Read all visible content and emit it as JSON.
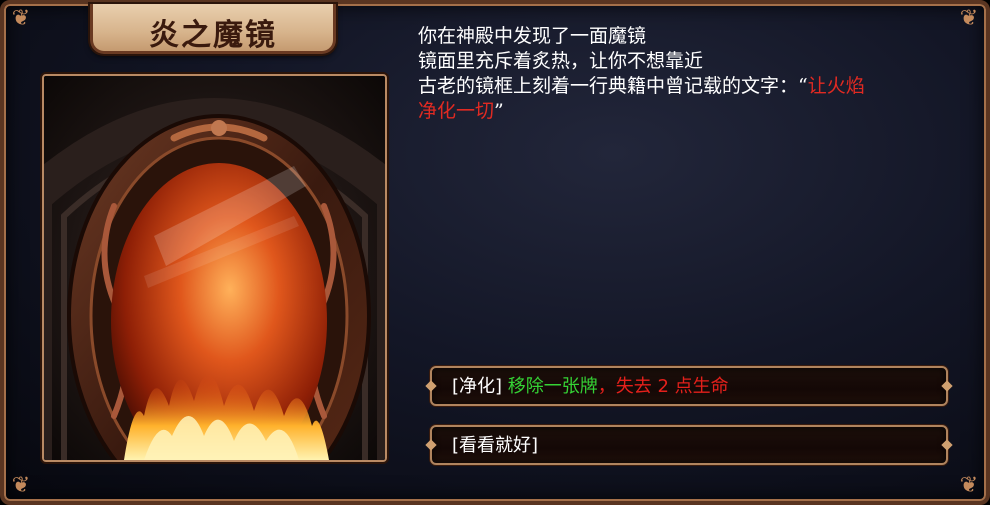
{
  "dialog": {
    "title": "炎之魔镜",
    "image_icon": "fire-mirror-illustration",
    "story": {
      "line1": "你在神殿中发现了一面魔镜",
      "line2": "镜面里充斥着炙热，让你不想靠近",
      "line3_prefix": "古老的镜框上刻着一行典籍中曾记载的文字：“",
      "quote_part1": "让火焰",
      "quote_part2": "净化一切",
      "quote_suffix": "”"
    },
    "options": [
      {
        "tag": "[净化]",
        "effect_good": "移除一张牌",
        "separator": "，",
        "effect_bad": "失去 2 点生命"
      },
      {
        "tag": "[看看就好]"
      }
    ],
    "colors": {
      "highlight_red": "#e12a22",
      "effect_green": "#35d335",
      "frame_gold": "#b0845e"
    }
  }
}
